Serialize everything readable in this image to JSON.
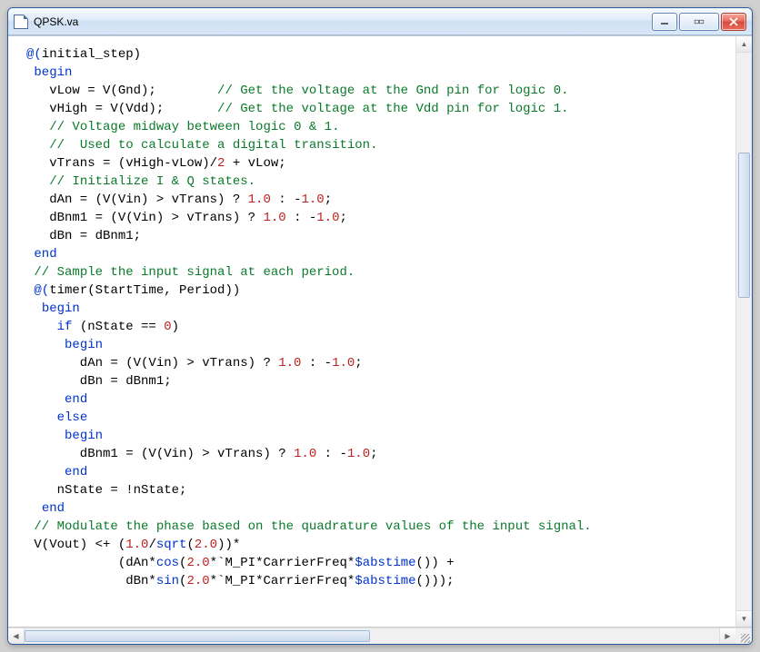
{
  "window": {
    "title": "QPSK.va"
  },
  "code": {
    "lines": [
      [
        [
          "@(",
          "kw"
        ],
        [
          "initial_step",
          "plain"
        ],
        [
          ")",
          "plain"
        ]
      ],
      [
        [
          " ",
          "plain"
        ],
        [
          "begin",
          "kw"
        ]
      ],
      [
        [
          "   vLow = V(Gnd);        ",
          "plain"
        ],
        [
          "// Get the voltage at the Gnd pin for logic 0.",
          "comment"
        ]
      ],
      [
        [
          "   vHigh = V(Vdd);       ",
          "plain"
        ],
        [
          "// Get the voltage at the Vdd pin for logic 1.",
          "comment"
        ]
      ],
      [
        [
          "   ",
          "plain"
        ],
        [
          "// Voltage midway between logic 0 & 1.",
          "comment"
        ]
      ],
      [
        [
          "   ",
          "plain"
        ],
        [
          "//  Used to calculate a digital transition.",
          "comment"
        ]
      ],
      [
        [
          "   vTrans = (vHigh-vLow)/",
          "plain"
        ],
        [
          "2",
          "num"
        ],
        [
          " + vLow;",
          "plain"
        ]
      ],
      [
        [
          "   ",
          "plain"
        ],
        [
          "// Initialize I & Q states.",
          "comment"
        ]
      ],
      [
        [
          "   dAn = (V(Vin) > vTrans) ? ",
          "plain"
        ],
        [
          "1.0",
          "num"
        ],
        [
          " : -",
          "plain"
        ],
        [
          "1.0",
          "num"
        ],
        [
          ";",
          "plain"
        ]
      ],
      [
        [
          "   dBnm1 = (V(Vin) > vTrans) ? ",
          "plain"
        ],
        [
          "1.0",
          "num"
        ],
        [
          " : -",
          "plain"
        ],
        [
          "1.0",
          "num"
        ],
        [
          ";",
          "plain"
        ]
      ],
      [
        [
          "   dBn = dBnm1;",
          "plain"
        ]
      ],
      [
        [
          " ",
          "plain"
        ],
        [
          "end",
          "kw"
        ]
      ],
      [
        [
          "",
          "plain"
        ]
      ],
      [
        [
          " ",
          "plain"
        ],
        [
          "// Sample the input signal at each period.",
          "comment"
        ]
      ],
      [
        [
          " ",
          "plain"
        ],
        [
          "@(",
          "kw"
        ],
        [
          "timer",
          "plain"
        ],
        [
          "(StartTime, Period))",
          "plain"
        ]
      ],
      [
        [
          "  ",
          "plain"
        ],
        [
          "begin",
          "kw"
        ]
      ],
      [
        [
          "    ",
          "plain"
        ],
        [
          "if",
          "kw"
        ],
        [
          " (nState == ",
          "plain"
        ],
        [
          "0",
          "num"
        ],
        [
          ")",
          "plain"
        ]
      ],
      [
        [
          "     ",
          "plain"
        ],
        [
          "begin",
          "kw"
        ]
      ],
      [
        [
          "       dAn = (V(Vin) > vTrans) ? ",
          "plain"
        ],
        [
          "1.0",
          "num"
        ],
        [
          " : -",
          "plain"
        ],
        [
          "1.0",
          "num"
        ],
        [
          ";",
          "plain"
        ]
      ],
      [
        [
          "       dBn = dBnm1;",
          "plain"
        ]
      ],
      [
        [
          "     ",
          "plain"
        ],
        [
          "end",
          "kw"
        ]
      ],
      [
        [
          "    ",
          "plain"
        ],
        [
          "else",
          "kw"
        ]
      ],
      [
        [
          "     ",
          "plain"
        ],
        [
          "begin",
          "kw"
        ]
      ],
      [
        [
          "       dBnm1 = (V(Vin) > vTrans) ? ",
          "plain"
        ],
        [
          "1.0",
          "num"
        ],
        [
          " : -",
          "plain"
        ],
        [
          "1.0",
          "num"
        ],
        [
          ";",
          "plain"
        ]
      ],
      [
        [
          "     ",
          "plain"
        ],
        [
          "end",
          "kw"
        ]
      ],
      [
        [
          "    nState = !nState;",
          "plain"
        ]
      ],
      [
        [
          "  ",
          "plain"
        ],
        [
          "end",
          "kw"
        ]
      ],
      [
        [
          "",
          "plain"
        ]
      ],
      [
        [
          " ",
          "plain"
        ],
        [
          "// Modulate the phase based on the quadrature values of the input signal.",
          "comment"
        ]
      ],
      [
        [
          " V(Vout) <+ (",
          "plain"
        ],
        [
          "1.0",
          "num"
        ],
        [
          "/",
          "plain"
        ],
        [
          "sqrt",
          "kw"
        ],
        [
          "(",
          "plain"
        ],
        [
          "2.0",
          "num"
        ],
        [
          "))*",
          "plain"
        ]
      ],
      [
        [
          "            (dAn*",
          "plain"
        ],
        [
          "cos",
          "kw"
        ],
        [
          "(",
          "plain"
        ],
        [
          "2.0",
          "num"
        ],
        [
          "*`M_PI*CarrierFreq*",
          "plain"
        ],
        [
          "$abstime",
          "kw"
        ],
        [
          "()) +",
          "plain"
        ]
      ],
      [
        [
          "             dBn*",
          "plain"
        ],
        [
          "sin",
          "kw"
        ],
        [
          "(",
          "plain"
        ],
        [
          "2.0",
          "num"
        ],
        [
          "*`M_PI*CarrierFreq*",
          "plain"
        ],
        [
          "$abstime",
          "kw"
        ],
        [
          "()));",
          "plain"
        ]
      ]
    ]
  }
}
